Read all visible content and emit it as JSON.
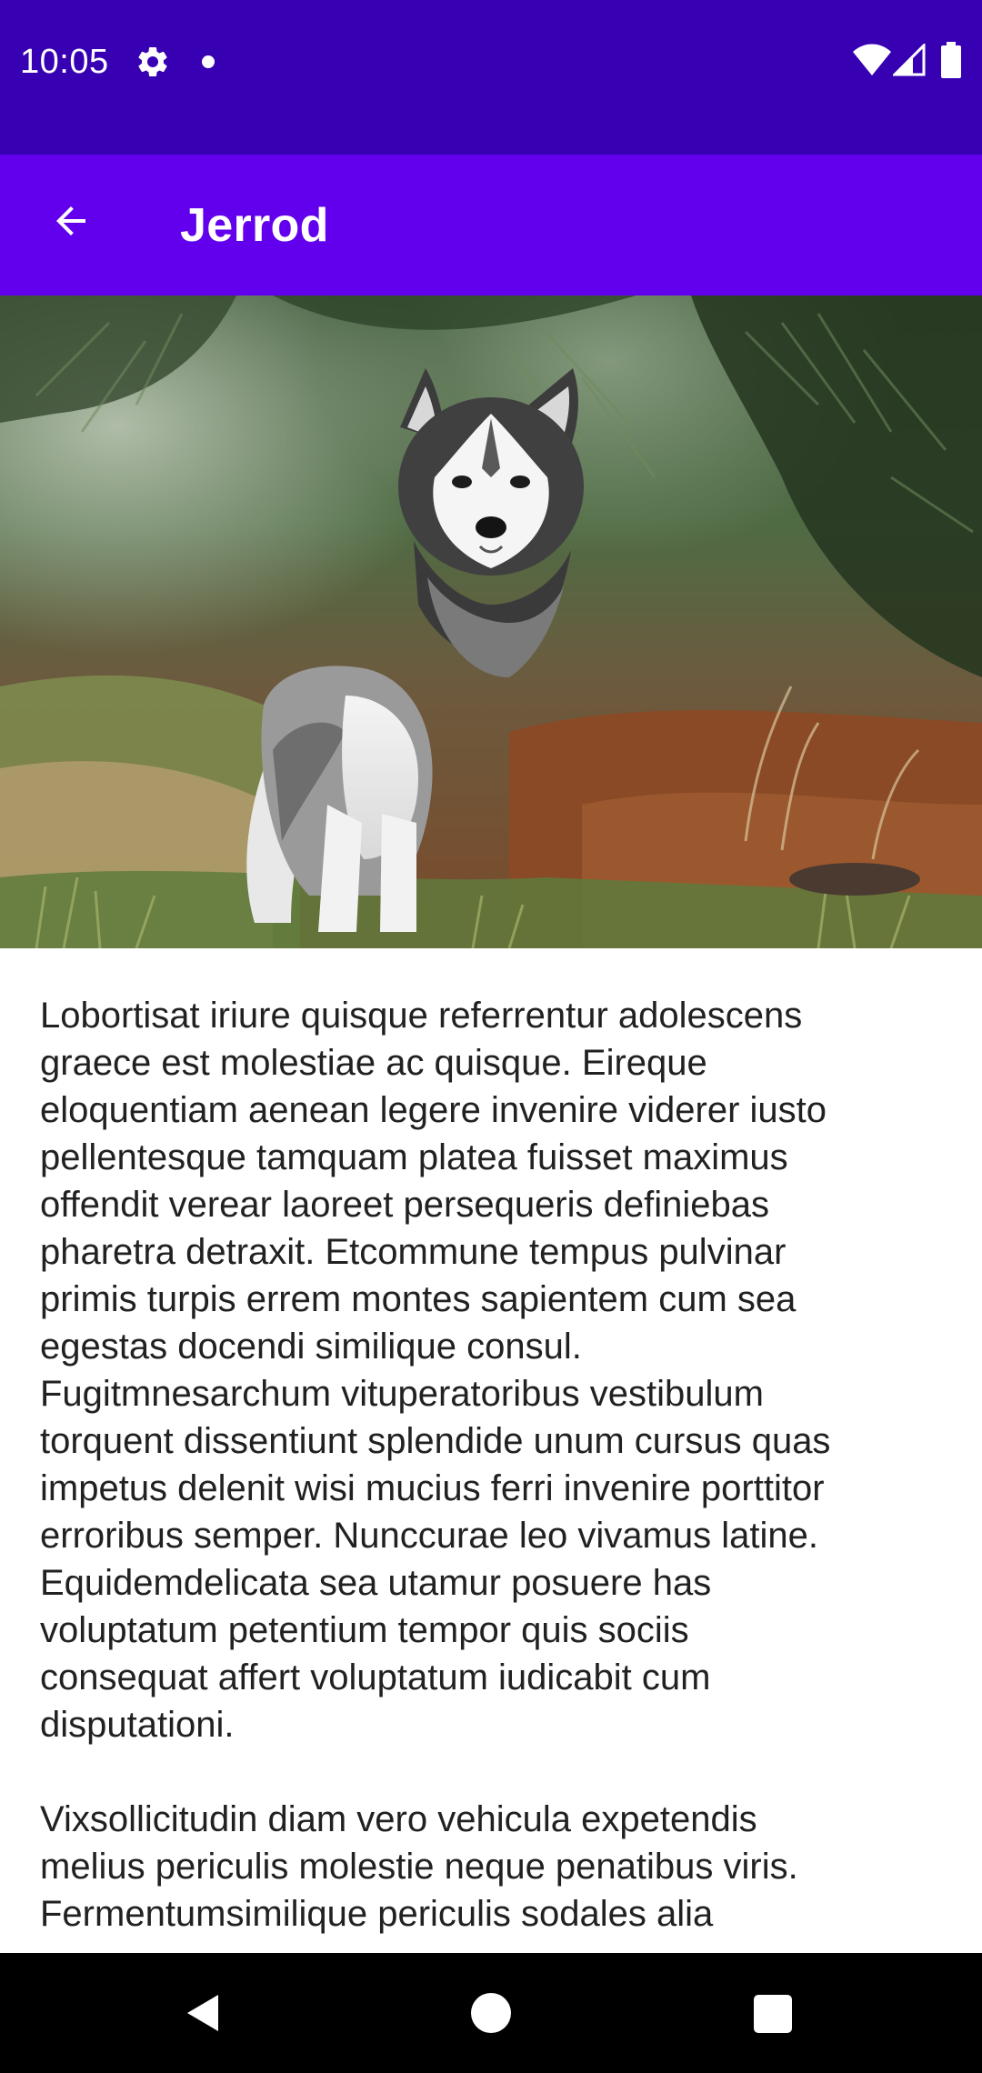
{
  "status_bar": {
    "time": "10:05",
    "icons": [
      "gear-icon",
      "notification-dot-icon",
      "wifi-icon",
      "cell-signal-icon",
      "battery-icon"
    ],
    "background": "#3700b3"
  },
  "app_bar": {
    "title": "Jerrod",
    "back_icon": "arrow-back-icon",
    "background": "#6200ee"
  },
  "hero_image": {
    "subject": "husky-puppy-photo"
  },
  "content": {
    "paragraphs": [
      "Lobortisat iriure quisque referrentur adolescens\ngraece est molestiae ac quisque.  Eireque\neloquentiam aenean legere invenire viderer iusto\npellentesque tamquam platea fuisset maximus\noffendit verear laoreet persequeris definiebas\npharetra detraxit.  Etcommune tempus pulvinar\nprimis turpis errem montes sapientem cum sea\negestas docendi similique consul.\nFugitmnesarchum vituperatoribus vestibulum\ntorquent dissentiunt splendide unum cursus quas\nimpetus delenit wisi mucius ferri invenire porttitor\nerroribus semper.  Nunccurae leo vivamus latine.\nEquidemdelicata sea utamur posuere has\nvoluptatum petentium tempor quis sociis\nconsequat affert voluptatum iudicabit cum\ndisputationi.",
      "Vixsollicitudin diam vero vehicula expetendis\nmelius periculis molestie neque penatibus viris.\nFermentumsimilique periculis sodales alia"
    ]
  },
  "nav_bar": {
    "icons": [
      "nav-back-icon",
      "nav-home-icon",
      "nav-recents-icon"
    ]
  }
}
